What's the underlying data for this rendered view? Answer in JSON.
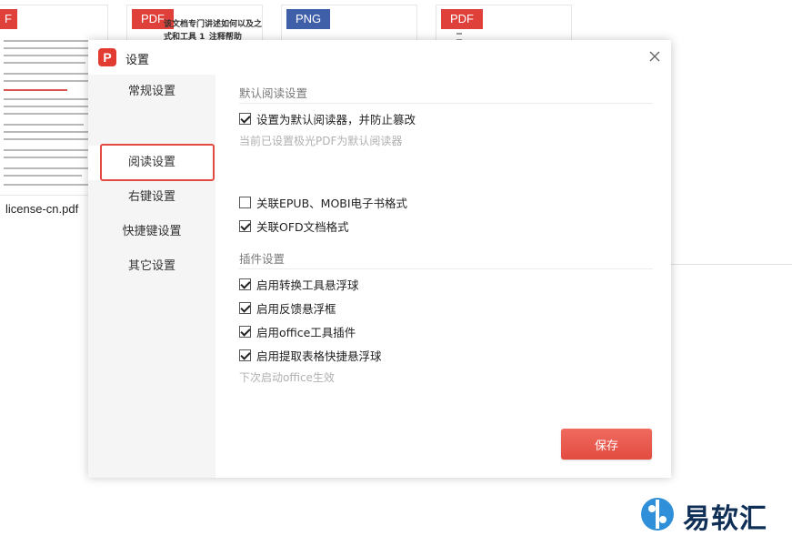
{
  "background": {
    "thumbs": [
      {
        "badge": "F",
        "type": "pdf"
      },
      {
        "badge": "PDF",
        "type": "pdf",
        "title": "该文档专门讲述如何以及之久更新方式和工具 1_注释帮助"
      },
      {
        "badge": "PNG",
        "type": "png"
      },
      {
        "badge": "PDF",
        "type": "pdf"
      }
    ],
    "file_name": "license-cn.pdf"
  },
  "dialog": {
    "title": "设置",
    "logo_letter": "P",
    "nav": [
      {
        "label": "常规设置"
      },
      {
        "label": "阅读设置"
      },
      {
        "label": "右键设置"
      },
      {
        "label": "快捷键设置"
      },
      {
        "label": "其它设置"
      }
    ],
    "active_nav": "阅读设置",
    "reader_section": {
      "title": "默认阅读设置",
      "options": [
        {
          "label": "设置为默认阅读器，并防止篡改",
          "checked": true
        },
        {
          "label": "关联EPUB、MOBI电子书格式",
          "checked": false
        },
        {
          "label": "关联OFD文档格式",
          "checked": true
        }
      ],
      "hint": "当前已设置极光PDF为默认阅读器"
    },
    "plugin_section": {
      "title": "插件设置",
      "options": [
        {
          "label": "启用转换工具悬浮球",
          "checked": true
        },
        {
          "label": "启用反馈悬浮框",
          "checked": true
        },
        {
          "label": "启用office工具插件",
          "checked": true
        },
        {
          "label": "启用提取表格快捷悬浮球",
          "checked": true
        }
      ],
      "hint": "下次启动office生效"
    },
    "save_label": "保存"
  },
  "watermark": {
    "text": "易软汇"
  },
  "colors": {
    "accent": "#e34b42",
    "badge_pdf": "#e0403a",
    "badge_png": "#3f5fa8",
    "brand_dark": "#0f2f57"
  }
}
